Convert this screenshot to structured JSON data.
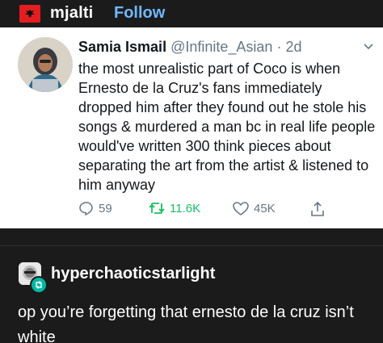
{
  "post": {
    "username": "mjalti",
    "follow_label": "Follow",
    "avatar_icon": "albanian-flag-icon"
  },
  "tweet": {
    "name": "Samia Ismail",
    "handle": "@Infinite_Asian",
    "separator": "·",
    "time": "2d",
    "text": "the most unrealistic part of Coco is when Ernesto de la Cruz's fans immediately dropped him after they found out he stole his songs & murdered a man bc in real life people would've written 300 think pieces about separating the art from the artist & listened to him anyway",
    "replies": "59",
    "retweets": "11.6K",
    "likes": "45K",
    "colors": {
      "retweet": "#17bf63",
      "muted": "#657786"
    }
  },
  "reblog": {
    "username": "hyperchaoticstarlight",
    "text": "op you’re forgetting that ernesto de la cruz isn’t white",
    "badge_icon": "reblog-icon"
  }
}
